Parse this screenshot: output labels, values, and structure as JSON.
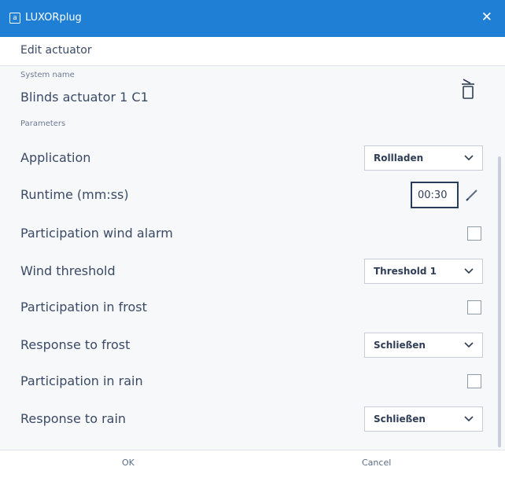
{
  "window": {
    "title": "LUXORplug",
    "app_icon_glyph": "a",
    "close_glyph": "✕",
    "accent_color": "#1f7fd4"
  },
  "header": {
    "title": "Edit actuator"
  },
  "system": {
    "name_label": "System name",
    "name_value": "Blinds actuator 1 C1"
  },
  "parameters": {
    "section_label": "Parameters",
    "application": {
      "label": "Application",
      "value": "Rollladen"
    },
    "runtime": {
      "label": "Runtime (mm:ss)",
      "value": "00:30"
    },
    "wind_alarm": {
      "label": "Participation wind alarm",
      "checked": false
    },
    "wind_threshold": {
      "label": "Wind threshold",
      "value": "Threshold 1"
    },
    "frost_participation": {
      "label": "Participation in frost",
      "checked": false
    },
    "frost_response": {
      "label": "Response to frost",
      "value": "Schließen"
    },
    "rain_participation": {
      "label": "Participation in rain",
      "checked": false
    },
    "rain_response": {
      "label": "Response to rain",
      "value": "Schließen"
    }
  },
  "footer": {
    "ok_label": "OK",
    "cancel_label": "Cancel"
  },
  "icons": {
    "delete": "trash-icon",
    "edit": "pencil-icon",
    "dropdown": "chevron-down-icon",
    "close": "close-icon"
  }
}
